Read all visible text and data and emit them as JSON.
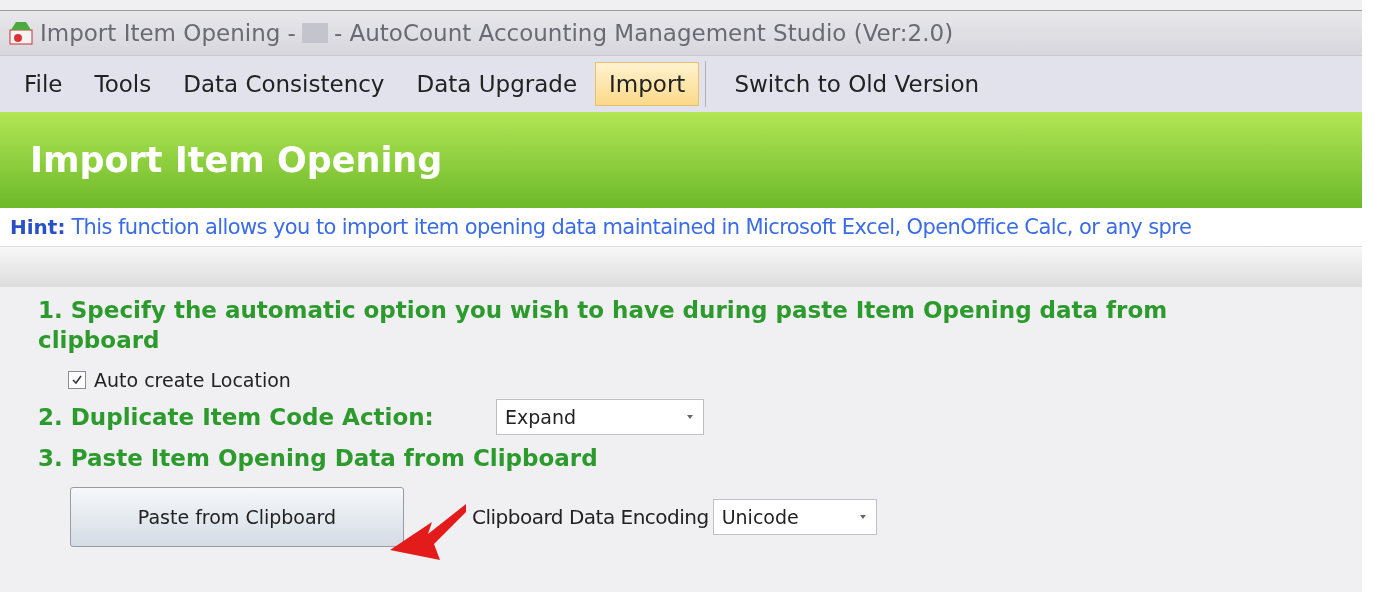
{
  "window": {
    "title_before": "Import Item Opening -",
    "title_after": "- AutoCount Accounting Management Studio (Ver:2.0)"
  },
  "menu": [
    {
      "label": "File",
      "selected": false
    },
    {
      "label": "Tools",
      "selected": false
    },
    {
      "label": "Data Consistency",
      "selected": false
    },
    {
      "label": "Data Upgrade",
      "selected": false
    },
    {
      "label": "Import",
      "selected": true
    },
    {
      "label": "Switch to Old Version",
      "selected": false
    }
  ],
  "banner": {
    "title": "Import Item Opening"
  },
  "hint": {
    "label": "Hint:",
    "text": "This function allows you to import item opening data maintained in Microsoft Excel, OpenOffice Calc, or any spre"
  },
  "steps": {
    "step1": "1. Specify the automatic option you wish to have during paste Item Opening data from clipboard",
    "auto_location": {
      "label": "Auto create Location",
      "checked": true
    },
    "step2": "2. Duplicate Item Code Action:",
    "duplicate_action": "Expand",
    "step3": "3. Paste Item Opening Data from Clipboard",
    "paste_button": "Paste from Clipboard",
    "encoding_label": "Clipboard Data Encoding",
    "encoding": "Unicode"
  }
}
